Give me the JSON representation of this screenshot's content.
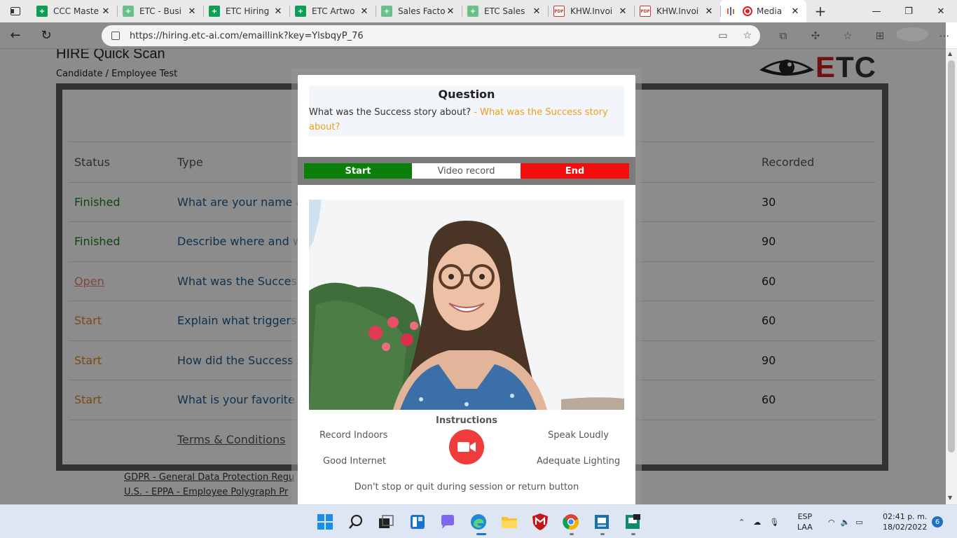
{
  "browser": {
    "tabs": [
      {
        "title": "CCC Maste",
        "icon": "sheets-icon"
      },
      {
        "title": "ETC - Busi",
        "icon": "sheets-icon"
      },
      {
        "title": "ETC Hiring",
        "icon": "sheets-icon"
      },
      {
        "title": "ETC Artwo",
        "icon": "sheets-icon"
      },
      {
        "title": "Sales Facto",
        "icon": "sheets-icon"
      },
      {
        "title": "ETC Sales",
        "icon": "sheets-icon"
      },
      {
        "title": "KHW.Invoi",
        "icon": "pdf-icon"
      },
      {
        "title": "KHW.Invoi",
        "icon": "pdf-icon"
      },
      {
        "title": "Media",
        "icon": "media-icon",
        "active": true
      }
    ],
    "url": "https://hiring.etc-ai.com/emaillink?key=YlsbqyP_76"
  },
  "page": {
    "title": "HIRE Quick Scan",
    "subtitle": "Candidate / Employee Test",
    "logo_text_e": "E",
    "logo_text_tc": "TC",
    "table": {
      "headers": {
        "status": "Status",
        "type": "Type",
        "recorded": "Recorded"
      },
      "rows": [
        {
          "status": "Finished",
          "type": "What are your name a",
          "recorded": "30"
        },
        {
          "status": "Finished",
          "type": "Describe where and w",
          "recorded": "90"
        },
        {
          "status": "Open",
          "type": "What was the Success",
          "recorded": "60"
        },
        {
          "status": "Start",
          "type": "Explain what triggers",
          "recorded": "60"
        },
        {
          "status": "Start",
          "type": "How did the Success s",
          "recorded": "90"
        },
        {
          "status": "Start",
          "type": "What is your favorite t",
          "recorded": "60"
        }
      ],
      "terms": "Terms & Conditions"
    },
    "footer_links": [
      "GDPR - General Data Protection Regu",
      "U.S. - EPPA - Employee Polygraph Pr"
    ]
  },
  "modal": {
    "question_heading": "Question",
    "question_text": "What was the Success story about?",
    "question_highlight": "- What was the Success story about?",
    "start_label": "Start",
    "video_label": "Video record",
    "end_label": "End",
    "instructions_title": "Instructions",
    "instructions": {
      "top_left": "Record Indoors",
      "top_right": "Speak Loudly",
      "bottom_left": "Good Internet",
      "bottom_right": "Adequate Lighting"
    },
    "notice": "Don't stop or quit during session or return button"
  },
  "taskbar": {
    "lang": "ESP",
    "layout": "LAA",
    "time": "02:41 p. m.",
    "date": "18/02/2022",
    "notifications": "6"
  },
  "colors": {
    "start": "#0a800a",
    "end": "#f40d0d",
    "record_button": "#ef3b3b",
    "finished": "#1e7d1e",
    "open": "#e8836b",
    "start_status": "#e08a1e"
  }
}
